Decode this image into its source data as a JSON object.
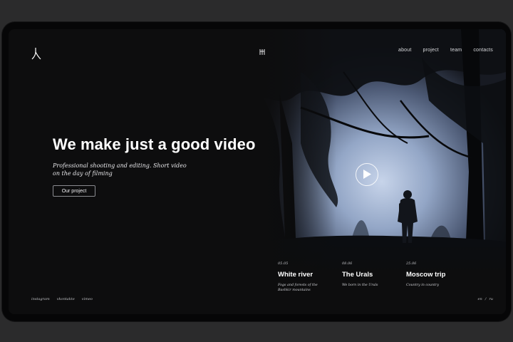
{
  "header": {
    "logo_icon": "person-glyph-icon",
    "center_icon": "brand-mark-icon",
    "nav": [
      {
        "label": "about"
      },
      {
        "label": "project"
      },
      {
        "label": "team"
      },
      {
        "label": "contacts"
      }
    ]
  },
  "hero": {
    "title": "We make just a good video",
    "subtitle": "Professional shooting and editing. Short video on the day of filming",
    "button_label": "Our project",
    "play_icon": "play-icon"
  },
  "projects": [
    {
      "date": "05.05",
      "title": "White river",
      "desc": "Fogs and forests of the Bashkir mountains",
      "active": true
    },
    {
      "date": "08.06",
      "title": "The Urals",
      "desc": "We born in the Urals",
      "active": false
    },
    {
      "date": "25.06",
      "title": "Moscow trip",
      "desc": "Country in country",
      "active": false
    }
  ],
  "footer": {
    "social": [
      {
        "label": "instagram"
      },
      {
        "label": "vkontakte"
      },
      {
        "label": "vimeo"
      }
    ],
    "lang": {
      "en": "en",
      "sep": "/",
      "ru": "ru"
    }
  },
  "colors": {
    "background": "#0d0d0e",
    "frame": "#060607",
    "text": "#ffffff",
    "fog": "#9fb1cf"
  }
}
